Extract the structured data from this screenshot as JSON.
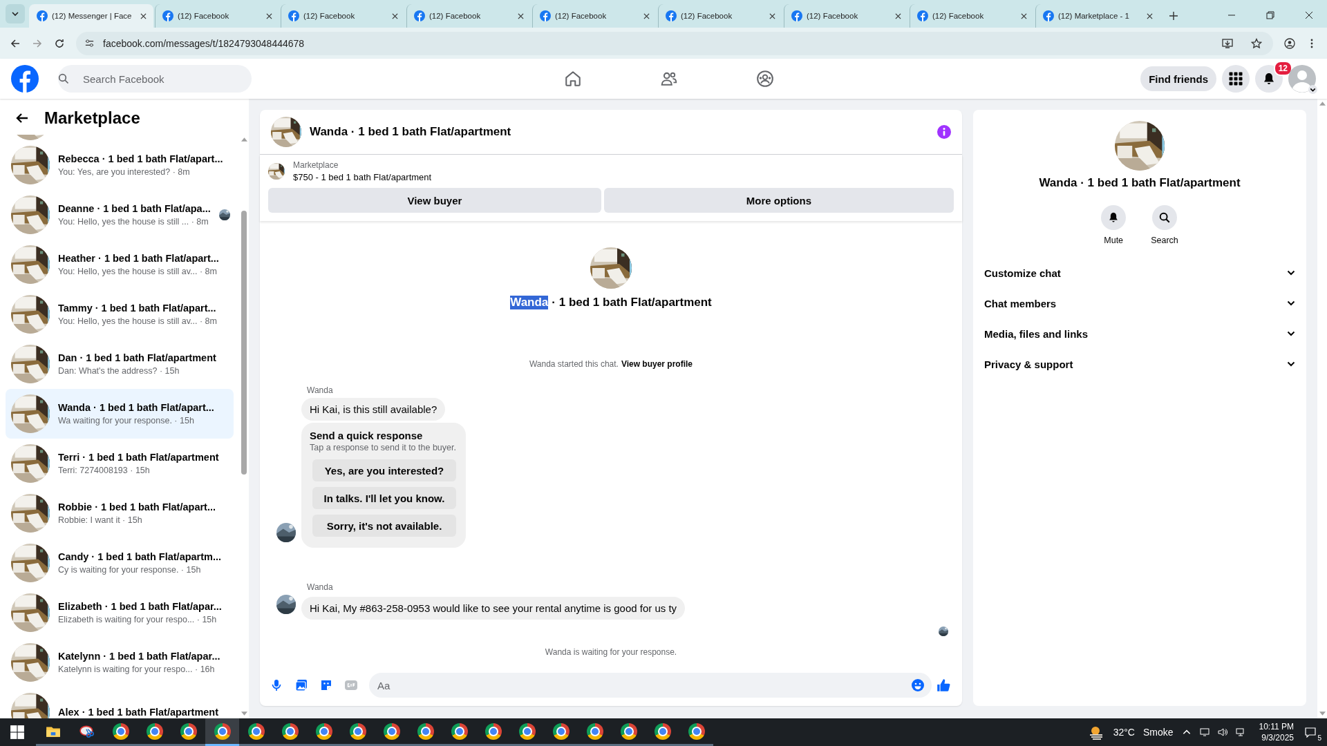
{
  "browser": {
    "tabs": [
      {
        "title": "(12) Messenger | Face",
        "selected": true
      },
      {
        "title": "(12) Facebook",
        "selected": false
      },
      {
        "title": "(12) Facebook",
        "selected": false
      },
      {
        "title": "(12) Facebook",
        "selected": false
      },
      {
        "title": "(12) Facebook",
        "selected": false
      },
      {
        "title": "(12) Facebook",
        "selected": false
      },
      {
        "title": "(12) Facebook",
        "selected": false
      },
      {
        "title": "(12) Facebook",
        "selected": false
      },
      {
        "title": "(12) Marketplace - 1",
        "selected": false
      }
    ],
    "url": "facebook.com/messages/t/1824793048444678"
  },
  "header": {
    "search_placeholder": "Search Facebook",
    "nav": [
      {
        "kind": "home"
      },
      {
        "kind": "friends"
      },
      {
        "kind": "groups"
      }
    ],
    "find_friends": "Find friends",
    "notification_count": "12"
  },
  "sidebar": {
    "title": "Marketplace",
    "conversations": [
      {
        "title": "Rebecca · 1 bed 1 bath Flat/apart...",
        "preview": "You: Yes, are you interested? · 8m",
        "selected": false,
        "seen": false
      },
      {
        "title": "Deanne · 1 bed 1 bath Flat/apa...",
        "preview": "You: Hello, yes the house is still ... · 8m",
        "selected": false,
        "seen": true
      },
      {
        "title": "Heather · 1 bed 1 bath Flat/apart...",
        "preview": "You: Hello, yes the house is still av... · 8m",
        "selected": false,
        "seen": false
      },
      {
        "title": "Tammy · 1 bed 1 bath Flat/apart...",
        "preview": "You: Hello, yes the house is still av... · 8m",
        "selected": false,
        "seen": false
      },
      {
        "title": "Dan · 1 bed 1 bath Flat/apartment",
        "preview": "Dan: What's the address? · 15h",
        "selected": false,
        "seen": false
      },
      {
        "title": "Wanda · 1 bed 1 bath Flat/apart...",
        "preview": "Wa waiting for your response. · 15h",
        "selected": true,
        "seen": false
      },
      {
        "title": "Terri · 1 bed 1 bath Flat/apartment",
        "preview": "Terri: 7274008193 · 15h",
        "selected": false,
        "seen": false
      },
      {
        "title": "Robbie · 1 bed 1 bath Flat/apart...",
        "preview": "Robbie: I want it · 15h",
        "selected": false,
        "seen": false
      },
      {
        "title": "Candy · 1 bed 1 bath Flat/apartm...",
        "preview": "Cy is waiting for your response. · 15h",
        "selected": false,
        "seen": false
      },
      {
        "title": "Elizabeth · 1 bed 1 bath Flat/apar...",
        "preview": "Elizabeth is waiting for your respo... · 15h",
        "selected": false,
        "seen": false
      },
      {
        "title": "Katelynn · 1 bed 1 bath Flat/apar...",
        "preview": "Katelynn is waiting for your respo... · 16h",
        "selected": false,
        "seen": false
      },
      {
        "title": "Alex · 1 bed 1 bath Flat/apartment",
        "selected": false,
        "seen": false
      }
    ]
  },
  "chat": {
    "title": "Wanda · 1 bed 1 bath Flat/apartment",
    "listing": {
      "source": "Marketplace",
      "title": "$750 - 1 bed 1 bath Flat/apartment"
    },
    "buttons": [
      "View buyer",
      "More options"
    ],
    "intro": {
      "name": "Wanda",
      "name_selected": true,
      "rest": "· 1 bed 1 bath Flat/apartment"
    },
    "note": {
      "text": "Wanda started this chat.",
      "link": "View buyer profile"
    },
    "messages": [
      {
        "sender": "Wanda",
        "text": "Hi Kai, is this still available?",
        "quick_response": {
          "title": "Send a quick response",
          "subtitle": "Tap a response to send it to the buyer.",
          "options": [
            "Yes, are you interested?",
            "In talks. I'll let you know.",
            "Sorry, it's not available."
          ]
        }
      },
      {
        "sender": "Wanda",
        "text": "Hi Kai, My #863-258-0953 would like to see your rental anytime is good for us ty"
      }
    ],
    "status": "Wanda is waiting for your response.",
    "composer": {
      "placeholder": "Aa"
    }
  },
  "details": {
    "title": "Wanda · 1 bed 1 bath Flat/apartment",
    "actions": [
      {
        "kind": "bell",
        "label": "Mute"
      },
      {
        "kind": "search",
        "label": "Search"
      }
    ],
    "sections": [
      {
        "label": "Customize chat",
        "expanded": false
      },
      {
        "label": "Chat members",
        "expanded": false
      },
      {
        "label": "Media, files and links",
        "expanded": false
      },
      {
        "label": "Privacy & support",
        "expanded": false
      }
    ]
  },
  "taskbar": {
    "apps": [
      {
        "kind": "files",
        "selected": false
      },
      {
        "kind": "snip",
        "selected": false
      },
      {
        "kind": "browser",
        "selected": false
      },
      {
        "kind": "browser",
        "selected": false
      },
      {
        "kind": "browser",
        "selected": false
      },
      {
        "kind": "browser",
        "selected": true
      },
      {
        "kind": "browser",
        "selected": false
      },
      {
        "kind": "browser",
        "selected": false
      },
      {
        "kind": "browser",
        "selected": false
      },
      {
        "kind": "browser",
        "selected": false
      },
      {
        "kind": "browser",
        "selected": false
      },
      {
        "kind": "browser",
        "selected": false
      },
      {
        "kind": "browser",
        "selected": false
      },
      {
        "kind": "browser",
        "selected": false
      },
      {
        "kind": "browser",
        "selected": false
      },
      {
        "kind": "browser",
        "selected": false
      },
      {
        "kind": "browser",
        "selected": false
      },
      {
        "kind": "browser",
        "selected": false
      },
      {
        "kind": "browser",
        "selected": false
      },
      {
        "kind": "browser",
        "selected": false
      }
    ],
    "temperature": "32°C",
    "weather": "Smoke",
    "time": "10:11 PM",
    "date": "9/3/2025",
    "notifications": "5"
  }
}
